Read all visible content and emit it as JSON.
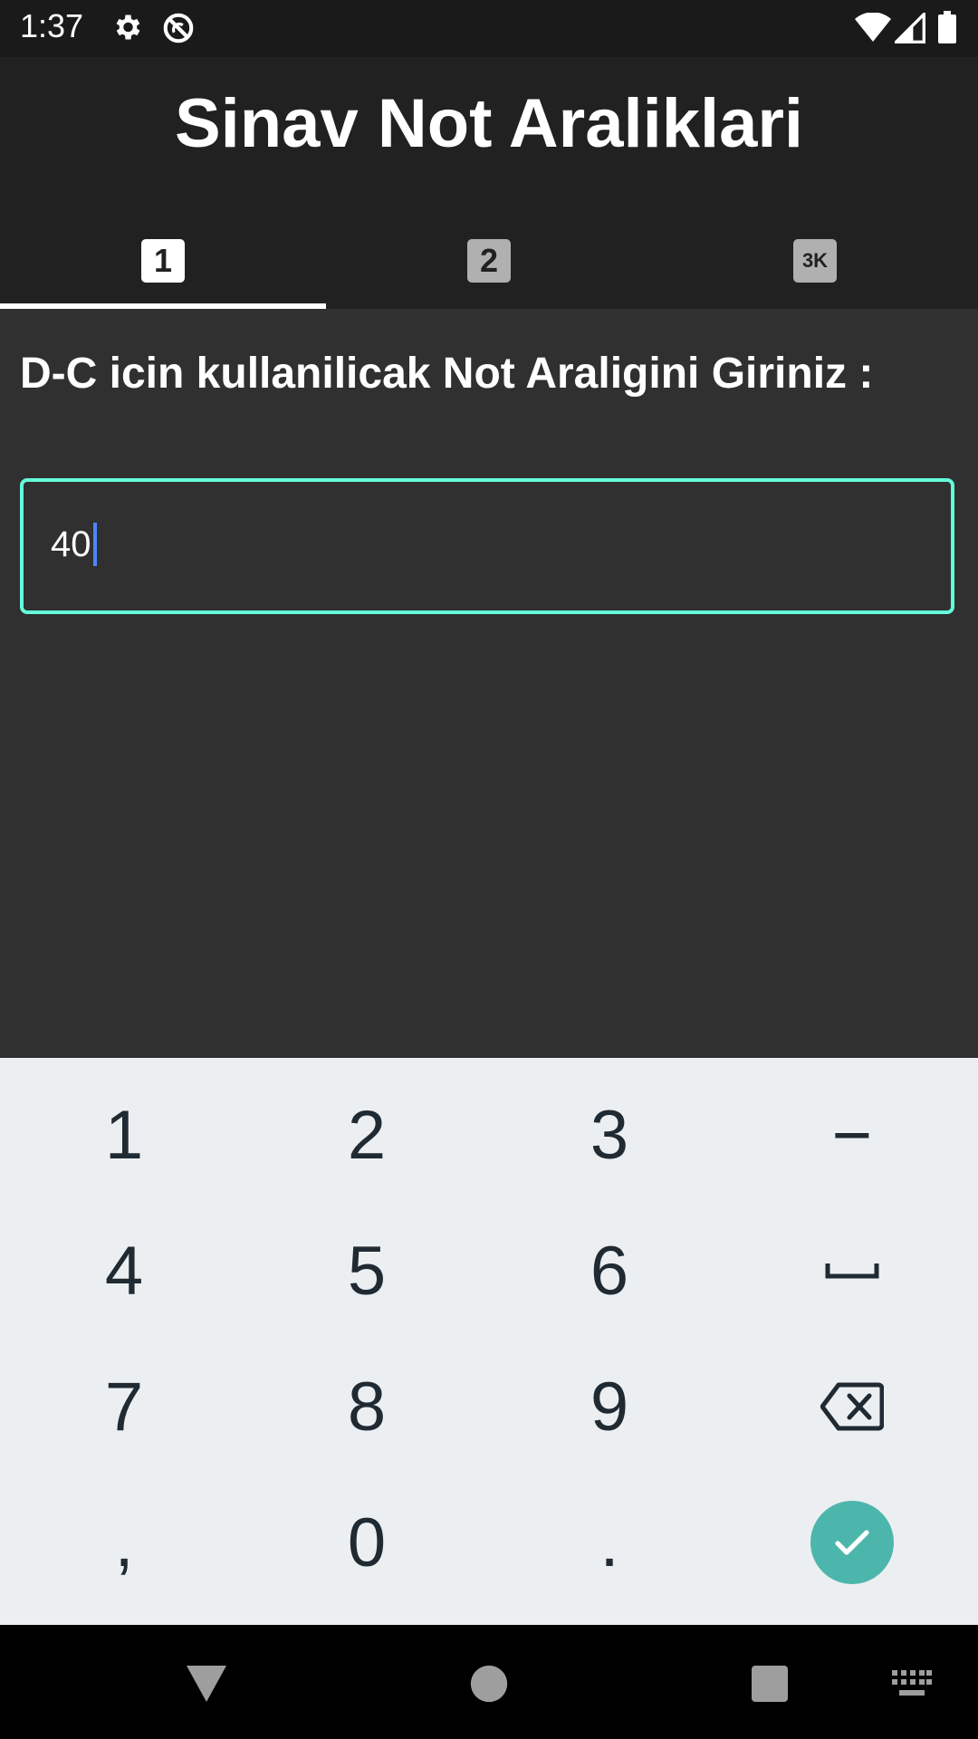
{
  "status_bar": {
    "time": "1:37",
    "icons": [
      "gear-icon",
      "no-sync-icon",
      "wifi-icon",
      "cell-signal-icon",
      "battery-icon"
    ]
  },
  "app": {
    "title": "Sinav Not Araliklari",
    "tabs": [
      {
        "label": "1",
        "icon": "number-1-icon",
        "selected": true
      },
      {
        "label": "2",
        "icon": "number-2-icon",
        "selected": false
      },
      {
        "label": "3K",
        "icon": "number-3k-icon",
        "selected": false
      }
    ]
  },
  "form": {
    "prompt": "D-C icin kullanilicak Not Araligini Giriniz :",
    "input_value": "40"
  },
  "keyboard": {
    "row1": [
      "1",
      "2",
      "3",
      "−"
    ],
    "row2": [
      "4",
      "5",
      "6",
      "space"
    ],
    "row3": [
      "7",
      "8",
      "9",
      "backspace"
    ],
    "row4": [
      ",",
      "0",
      ".",
      "done"
    ]
  },
  "colors": {
    "accent": "#64ffda",
    "done_button": "#4db6ac",
    "caret": "#4f83ff"
  },
  "nav_bar": {
    "buttons": [
      "back-icon",
      "home-icon",
      "recents-icon",
      "keyboard-switch-icon"
    ]
  }
}
